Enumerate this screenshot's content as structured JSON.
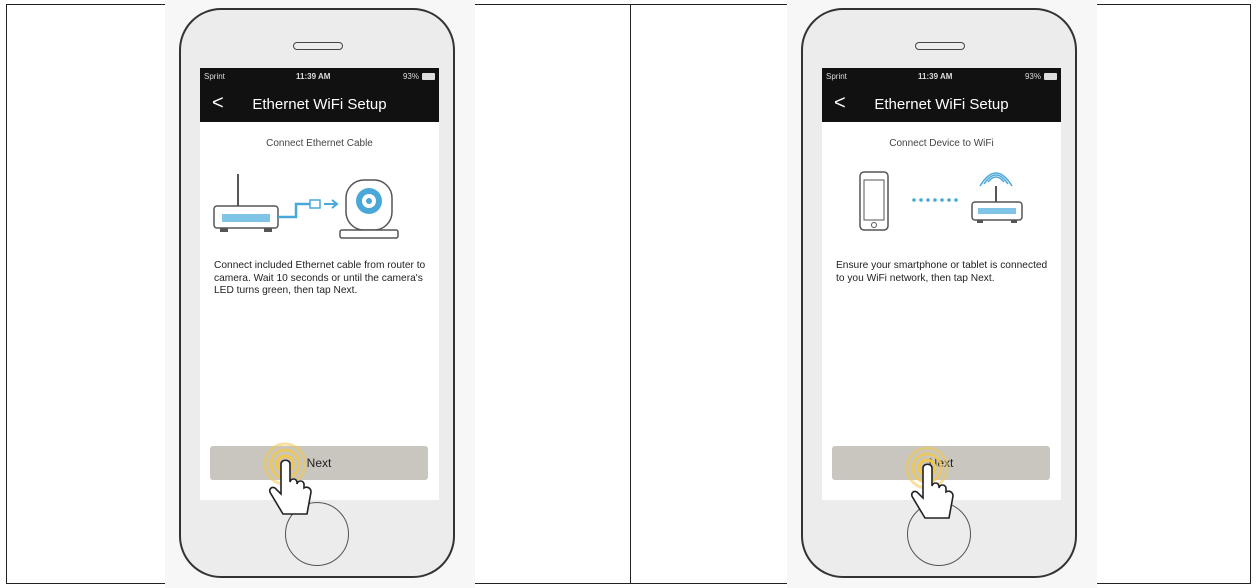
{
  "panels": [
    {
      "status": {
        "carrier": "Sprint",
        "time": "11:39 AM",
        "battery": "93%"
      },
      "nav": {
        "back": "<",
        "title": "Ethernet WiFi Setup"
      },
      "heading": "Connect Ethernet Cable",
      "description": "Connect included Ethernet cable from router to camera. Wait 10 seconds or until the camera's LED turns green, then tap Next.",
      "next_label": "Next"
    },
    {
      "status": {
        "carrier": "Sprint",
        "time": "11:39 AM",
        "battery": "93%"
      },
      "nav": {
        "back": "<",
        "title": "Ethernet WiFi Setup"
      },
      "heading": "Connect Device to WiFi",
      "description": "Ensure your smartphone or tablet is connected to you WiFi network, then tap Next.",
      "next_label": "Next"
    }
  ],
  "colors": {
    "accent": "#4aa8d8",
    "tap_ring": "#f2c84b",
    "button": "#c9c5bf",
    "navbar": "#111111"
  }
}
